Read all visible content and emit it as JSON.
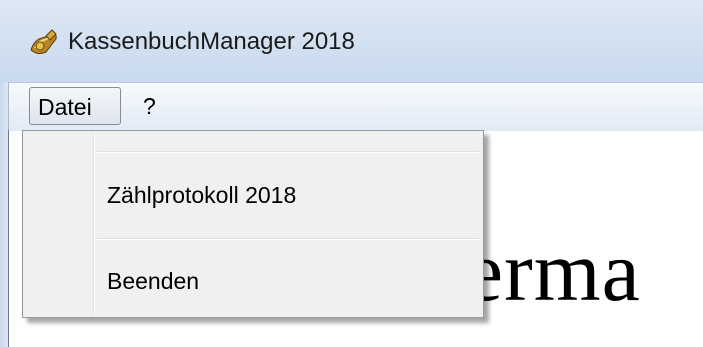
{
  "window": {
    "title": "KassenbuchManager 2018",
    "icon": "cash-book-app-icon"
  },
  "menubar": {
    "items": [
      {
        "label": "Datei"
      },
      {
        "label": "?"
      }
    ]
  },
  "dropdown": {
    "items": [
      {
        "label": "Zählprotokoll 2018"
      },
      {
        "label": "Beenden"
      }
    ]
  },
  "content": {
    "partial_text": "terma"
  },
  "colors": {
    "titlebar": "#d3e1f1",
    "menubar": "#edf2f9",
    "dropdown_bg": "#f0f0f0"
  }
}
